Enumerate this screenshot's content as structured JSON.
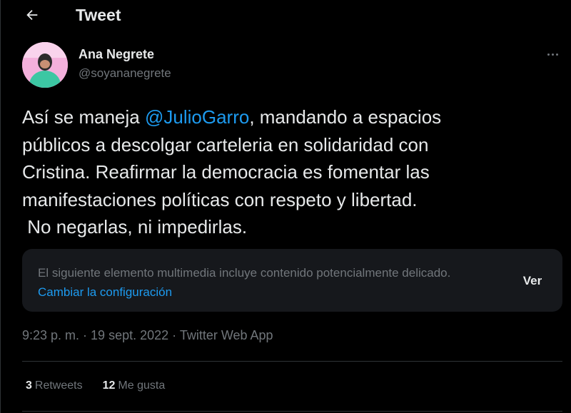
{
  "header": {
    "title": "Tweet"
  },
  "author": {
    "display_name": "Ana Negrete",
    "handle": "@soyananegrete"
  },
  "tweet": {
    "text_before": "Así se maneja ",
    "mention": "@JulioGarro",
    "text_after": ", mandando a espacios\npúblicos a descolgar carteleria en solidaridad con\nCristina. Reafirmar la democracia es fomentar las\nmanifestaciones políticas con respeto y libertad.\n No negarlas, ni impedirlas."
  },
  "sensitive_media": {
    "warning": "El siguiente elemento multimedia incluye contenido potencialmente delicado.",
    "settings_link": "Cambiar la configuración",
    "view_label": "Ver"
  },
  "meta": {
    "time": "9:23 p. m.",
    "sep1": " · ",
    "date": "19 sept. 2022",
    "sep2": " · ",
    "source": "Twitter Web App"
  },
  "stats": {
    "retweets_count": "3",
    "retweets_label": "Retweets",
    "likes_count": "12",
    "likes_label": "Me gusta"
  },
  "colors": {
    "background": "#000000",
    "text": "#e7e9ea",
    "muted": "#71767b",
    "accent": "#1d9bf0",
    "card": "#16181c",
    "border": "#2f3336"
  },
  "icons": {
    "back": "arrow-left-icon",
    "more": "more-horizontal-icon"
  }
}
